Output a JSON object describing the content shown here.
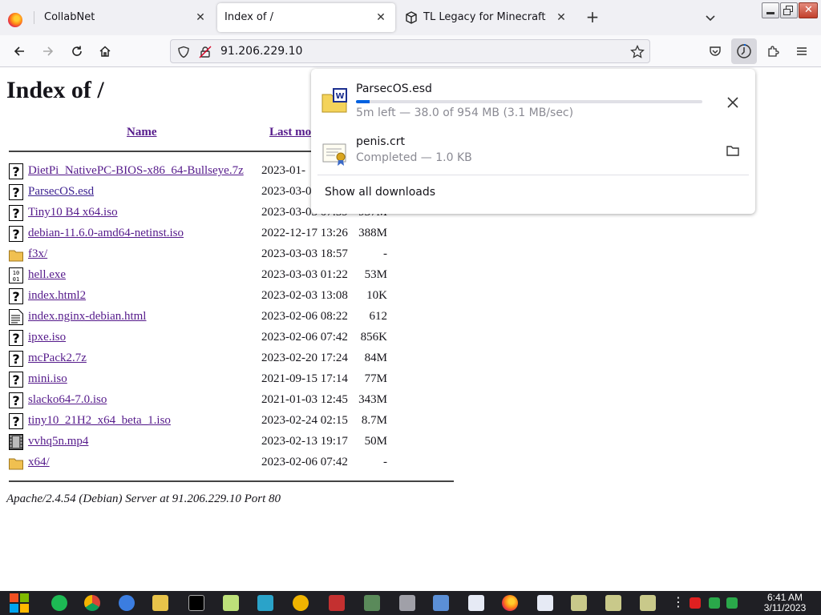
{
  "tabs": [
    {
      "title": "CollabNet"
    },
    {
      "title": "Index of /"
    },
    {
      "title": "TL Legacy for Minecraft"
    }
  ],
  "url": "91.206.229.10",
  "page": {
    "heading": "Index of /",
    "columns": {
      "name": "Name",
      "last_modified": "Last mo"
    },
    "files": [
      {
        "name": "DietPi_NativePC-BIOS-x86_64-Bullseye.7z",
        "date": "2023-01-",
        "size": "",
        "icon": "unknown-file-icon"
      },
      {
        "name": "ParsecOS.esd",
        "date": "2023-03-0",
        "size": "",
        "icon": "unknown-file-icon"
      },
      {
        "name": "Tiny10 B4 x64.iso",
        "date": "2023-03-03 07:39",
        "size": "937M",
        "icon": "unknown-file-icon"
      },
      {
        "name": "debian-11.6.0-amd64-netinst.iso",
        "date": "2022-12-17 13:26",
        "size": "388M",
        "icon": "unknown-file-icon"
      },
      {
        "name": "f3x/",
        "date": "2023-03-03 18:57",
        "size": "-",
        "icon": "folder-icon"
      },
      {
        "name": "hell.exe",
        "date": "2023-03-03 01:22",
        "size": "53M",
        "icon": "binary-file-icon"
      },
      {
        "name": "index.html2",
        "date": "2023-02-03 13:08",
        "size": "10K",
        "icon": "unknown-file-icon"
      },
      {
        "name": "index.nginx-debian.html",
        "date": "2023-02-06 08:22",
        "size": "612",
        "icon": "text-file-icon"
      },
      {
        "name": "ipxe.iso",
        "date": "2023-02-06 07:42",
        "size": "856K",
        "icon": "unknown-file-icon"
      },
      {
        "name": "mcPack2.7z",
        "date": "2023-02-20 17:24",
        "size": "84M",
        "icon": "unknown-file-icon"
      },
      {
        "name": "mini.iso",
        "date": "2021-09-15 17:14",
        "size": "77M",
        "icon": "unknown-file-icon"
      },
      {
        "name": "slacko64-7.0.iso",
        "date": "2021-01-03 12:45",
        "size": "343M",
        "icon": "unknown-file-icon"
      },
      {
        "name": "tiny10_21H2_x64_beta_1.iso",
        "date": "2023-02-24 02:15",
        "size": "8.7M",
        "icon": "unknown-file-icon"
      },
      {
        "name": "vvhq5n.mp4",
        "date": "2023-02-13 19:17",
        "size": "50M",
        "icon": "video-file-icon"
      },
      {
        "name": "x64/",
        "date": "2023-02-06 07:42",
        "size": "-",
        "icon": "folder-icon"
      }
    ],
    "address": "Apache/2.4.54 (Debian) Server at 91.206.229.10 Port 80"
  },
  "downloads": {
    "items": [
      {
        "name": "ParsecOS.esd",
        "status": "5m left — 38.0 of 954 MB (3.1 MB/sec)",
        "progress": 0.04,
        "action": "cancel"
      },
      {
        "name": "penis.crt",
        "status": "Completed — 1.0 KB",
        "action": "open-folder"
      }
    ],
    "show_all": "Show all downloads"
  },
  "clock": {
    "time": "6:41 AM",
    "date": "3/11/2023"
  },
  "colors": {
    "accent": "#0061e0",
    "visited_link": "#551a8b",
    "taskbar": "#1f1f24"
  }
}
